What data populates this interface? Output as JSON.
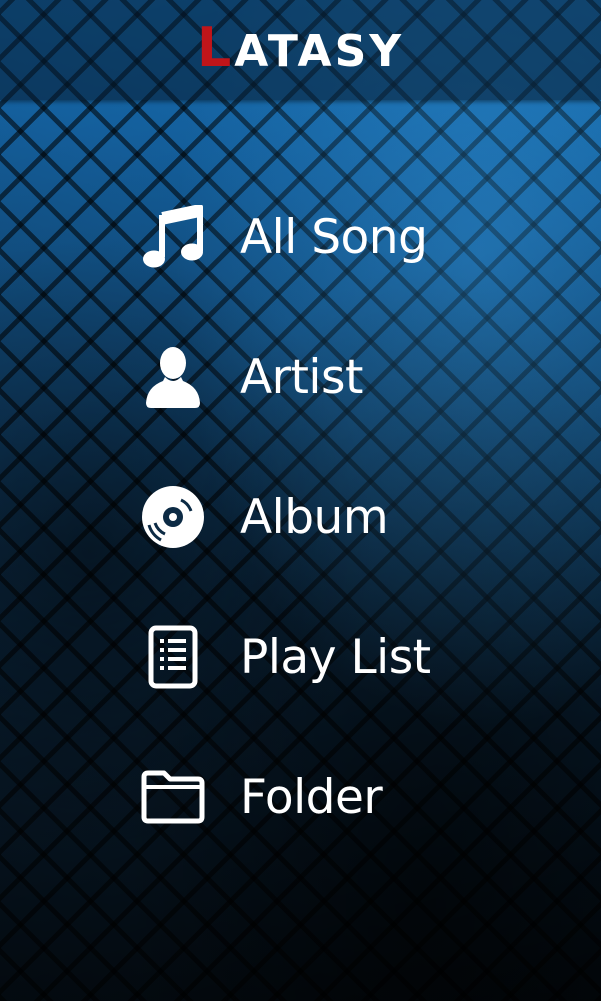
{
  "app": {
    "logo_first_letter": "L",
    "logo_rest": "ATASY",
    "accent_color": "#c0151a"
  },
  "menu": {
    "items": [
      {
        "label": "All Song",
        "icon": "music-note-icon"
      },
      {
        "label": "Artist",
        "icon": "person-icon"
      },
      {
        "label": "Album",
        "icon": "disc-icon"
      },
      {
        "label": "Play List",
        "icon": "playlist-document-icon"
      },
      {
        "label": "Folder",
        "icon": "folder-icon"
      }
    ]
  }
}
